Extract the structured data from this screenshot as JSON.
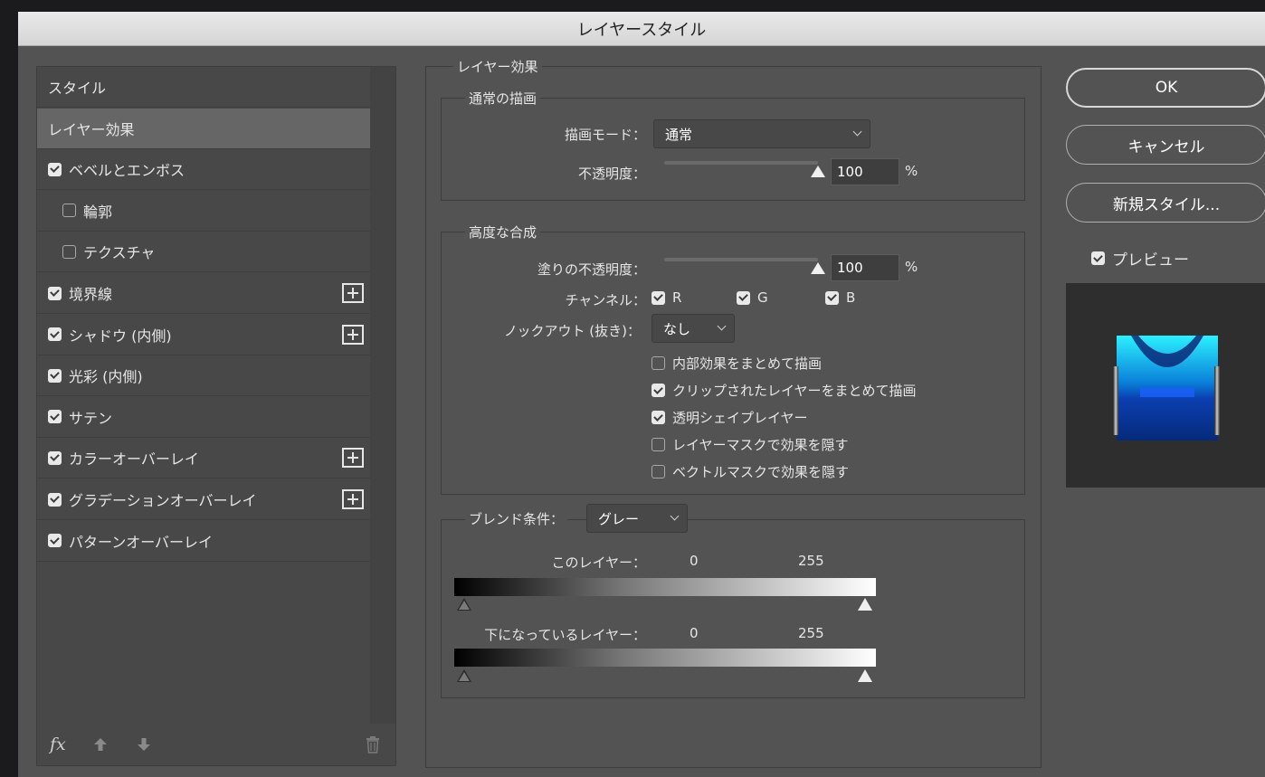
{
  "window": {
    "title": "レイヤースタイル"
  },
  "style_list": {
    "items": [
      {
        "label": "スタイル",
        "checkbox": null,
        "indent": false,
        "selected": false,
        "plus": false
      },
      {
        "label": "レイヤー効果",
        "checkbox": null,
        "indent": false,
        "selected": true,
        "plus": false
      },
      {
        "label": "ベベルとエンボス",
        "checkbox": true,
        "indent": false,
        "selected": false,
        "plus": false
      },
      {
        "label": "輪郭",
        "checkbox": false,
        "indent": true,
        "selected": false,
        "plus": false
      },
      {
        "label": "テクスチャ",
        "checkbox": false,
        "indent": true,
        "selected": false,
        "plus": false
      },
      {
        "label": "境界線",
        "checkbox": true,
        "indent": false,
        "selected": false,
        "plus": true
      },
      {
        "label": "シャドウ (内側)",
        "checkbox": true,
        "indent": false,
        "selected": false,
        "plus": true
      },
      {
        "label": "光彩 (内側)",
        "checkbox": true,
        "indent": false,
        "selected": false,
        "plus": false
      },
      {
        "label": "サテン",
        "checkbox": true,
        "indent": false,
        "selected": false,
        "plus": false
      },
      {
        "label": "カラーオーバーレイ",
        "checkbox": true,
        "indent": false,
        "selected": false,
        "plus": true
      },
      {
        "label": "グラデーションオーバーレイ",
        "checkbox": true,
        "indent": false,
        "selected": false,
        "plus": true
      },
      {
        "label": "パターンオーバーレイ",
        "checkbox": true,
        "indent": false,
        "selected": false,
        "plus": false
      }
    ],
    "footer": {
      "fx_label": "fx"
    }
  },
  "layer_effects": {
    "legend": "レイヤー効果",
    "normal_blend": {
      "legend": "通常の描画",
      "blend_mode_label": "描画モード：",
      "blend_mode_value": "通常",
      "opacity_label": "不透明度：",
      "opacity_value": "100",
      "opacity_unit": "%",
      "opacity_fraction": 1.0
    },
    "advanced_blend": {
      "legend": "高度な合成",
      "fill_opacity_label": "塗りの不透明度：",
      "fill_opacity_value": "100",
      "fill_opacity_unit": "%",
      "fill_opacity_fraction": 1.0,
      "channels_label": "チャンネル：",
      "channels": [
        {
          "label": "R",
          "checked": true
        },
        {
          "label": "G",
          "checked": true
        },
        {
          "label": "B",
          "checked": true
        }
      ],
      "knockout_label": "ノックアウト (抜き)：",
      "knockout_value": "なし",
      "options": [
        {
          "label": "内部効果をまとめて描画",
          "checked": false
        },
        {
          "label": "クリップされたレイヤーをまとめて描画",
          "checked": true
        },
        {
          "label": "透明シェイプレイヤー",
          "checked": true
        },
        {
          "label": "レイヤーマスクで効果を隠す",
          "checked": false
        },
        {
          "label": "ベクトルマスクで効果を隠す",
          "checked": false
        }
      ]
    },
    "blend_if": {
      "legend": "ブレンド条件：",
      "value": "グレー",
      "this_layer_label": "このレイヤー：",
      "this_layer_min": "0",
      "this_layer_max": "255",
      "underlying_label": "下になっているレイヤー：",
      "underlying_min": "0",
      "underlying_max": "255"
    }
  },
  "buttons": {
    "ok": "OK",
    "cancel": "キャンセル",
    "new_style": "新規スタイル..."
  },
  "preview": {
    "label": "プレビュー",
    "checked": true
  }
}
